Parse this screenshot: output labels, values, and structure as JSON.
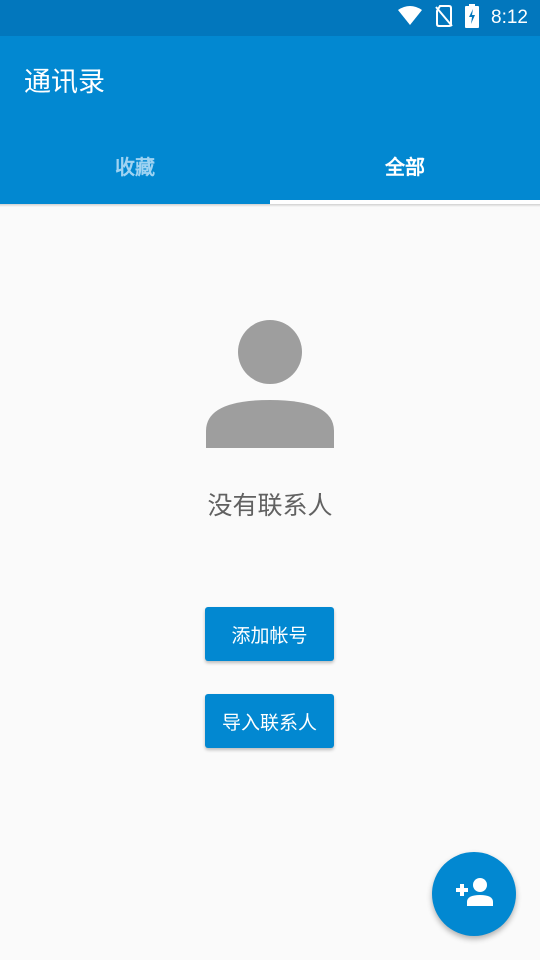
{
  "status_bar": {
    "time": "8:12",
    "icons": [
      "wifi-icon",
      "no-sim-icon",
      "battery-charging-icon"
    ]
  },
  "app_bar": {
    "title": "通讯录",
    "tabs": [
      {
        "label": "收藏",
        "active": false
      },
      {
        "label": "全部",
        "active": true
      }
    ]
  },
  "empty_state": {
    "icon": "person-silhouette-icon",
    "message": "没有联系人"
  },
  "actions": {
    "add_account_label": "添加帐号",
    "import_contacts_label": "导入联系人"
  },
  "fab": {
    "icon": "add-person-icon"
  },
  "colors": {
    "status_bar": "#0277bd",
    "primary": "#0288d1",
    "background": "#fafafa",
    "icon_gray": "#9e9e9e",
    "text_gray": "#616161",
    "inactive_tab": "#9fd3f2"
  }
}
